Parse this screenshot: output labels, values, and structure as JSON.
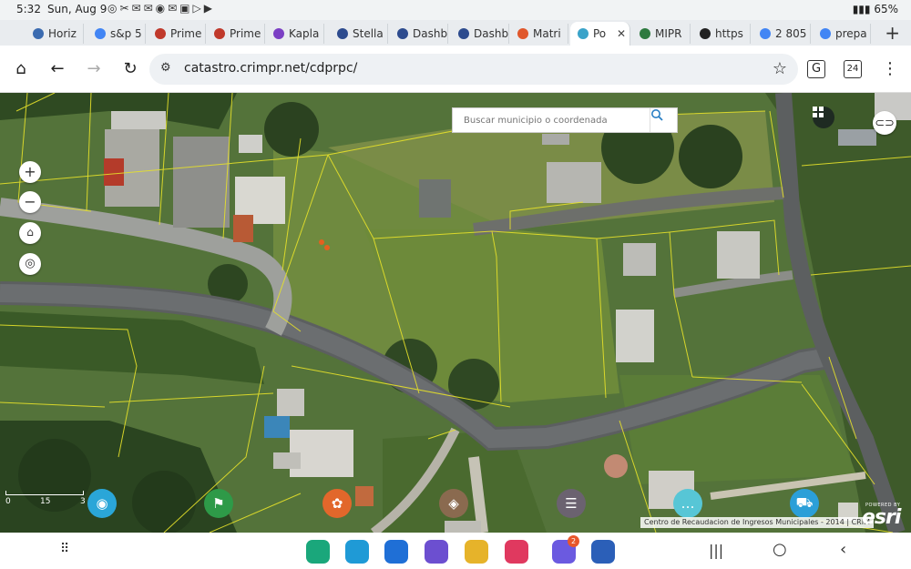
{
  "status_bar": {
    "time": "5:32",
    "date": "Sun, Aug 9",
    "notif_icons": "◎✂✉✉◉✉▣▷▶",
    "battery": "65%"
  },
  "tabs": [
    {
      "label": "Horiz",
      "fav": "#3b6bb0"
    },
    {
      "label": "s&p 5",
      "fav": "#4285f4"
    },
    {
      "label": "Prime",
      "fav": "#c0392b"
    },
    {
      "label": "Prime",
      "fav": "#c0392b"
    },
    {
      "label": "Kapla",
      "fav": "#7b3fc4"
    },
    {
      "label": "Stella",
      "fav": "#2d4b8e"
    },
    {
      "label": "Dashb",
      "fav": "#2d4b8e"
    },
    {
      "label": "Dashb",
      "fav": "#2d4b8e"
    },
    {
      "label": "Matri",
      "fav": "#e0572b"
    },
    {
      "label": "Po",
      "fav": "#3aa3c9",
      "active": true
    },
    {
      "label": "MIPR",
      "fav": "#2d7a3f"
    },
    {
      "label": "https",
      "fav": "#222222"
    },
    {
      "label": "2 805",
      "fav": "#4285f4"
    },
    {
      "label": "prepa",
      "fav": "#4285f4"
    }
  ],
  "toolbar": {
    "url": "catastro.crimpr.net/cdprpc/",
    "tab_count": "24"
  },
  "map": {
    "search_placeholder": "Buscar municipio o coordenada",
    "zoom_in": "+",
    "zoom_out": "−",
    "attribution": "Centro de Recaudacion de Ingresos Municipales - 2014 | CRIM",
    "powered_by": "POWERED BY",
    "logo_text": "esri",
    "scale_labels": [
      "0",
      "15",
      "3"
    ],
    "bottom_tools": [
      {
        "name": "binoculars",
        "color": "#2aa6d8",
        "glyph": "◉"
      },
      {
        "name": "flag",
        "color": "#2e9a48",
        "glyph": "⚑"
      },
      {
        "name": "film",
        "color": "#e2672b",
        "glyph": "✿"
      },
      {
        "name": "layers",
        "color": "#8a6a4f",
        "glyph": "◈"
      },
      {
        "name": "list",
        "color": "#6b6270",
        "glyph": "☰"
      },
      {
        "name": "chat",
        "color": "#57c6d6",
        "glyph": "…"
      },
      {
        "name": "cart",
        "color": "#2b9fd8",
        "glyph": "⛟"
      }
    ]
  },
  "nav_bar": {
    "apps": [
      {
        "name": "phone",
        "color": "#1aa77b"
      },
      {
        "name": "messages",
        "color": "#1f9ad6"
      },
      {
        "name": "mail",
        "color": "#1f6fd6"
      },
      {
        "name": "video",
        "color": "#6c4fd0"
      },
      {
        "name": "chrome",
        "color": "#e6b32a"
      },
      {
        "name": "camera",
        "color": "#e0395f"
      },
      {
        "name": "email",
        "color": "#6b5ae0",
        "badge": "2"
      },
      {
        "name": "word",
        "color": "#2b5fb8"
      }
    ]
  }
}
